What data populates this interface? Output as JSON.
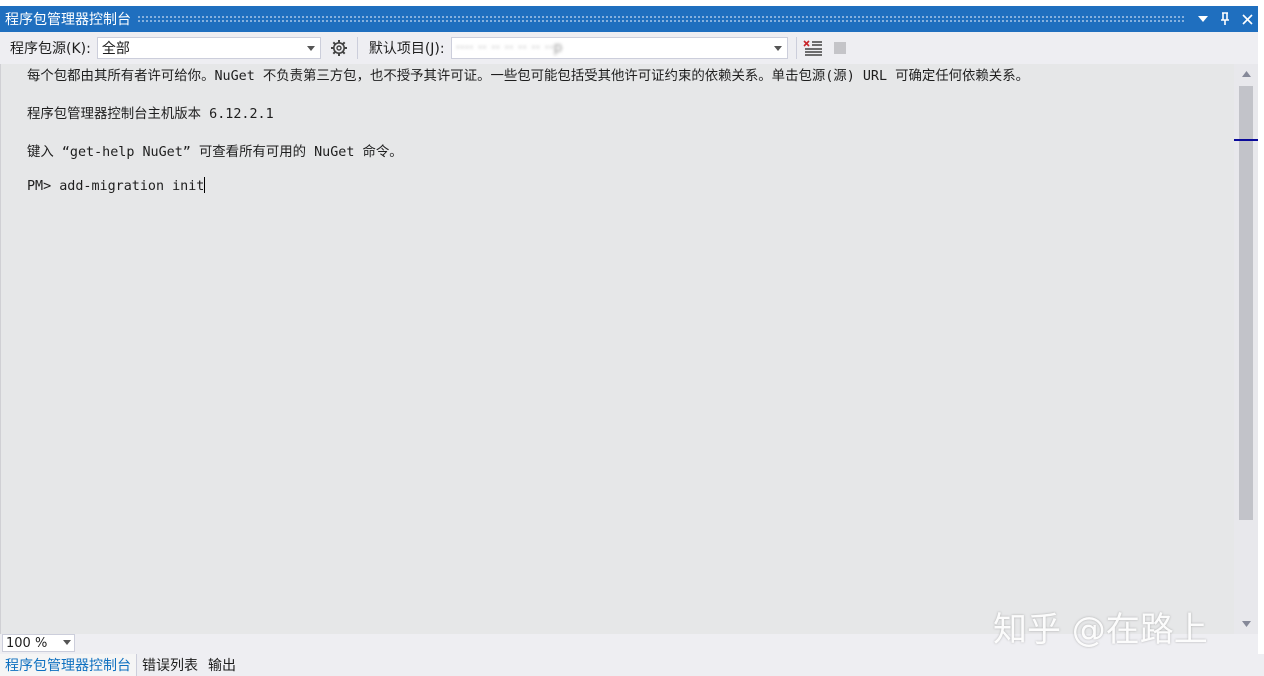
{
  "window": {
    "title": "程序包管理器控制台",
    "buttons": {
      "dropdown": "▾",
      "pin": "⊥",
      "close": "✕"
    }
  },
  "toolbar": {
    "source_label": "程序包源(K):",
    "source_value": "全部",
    "default_project_label": "默认项目(J):",
    "default_project_value": "···· ·· ·· ·· ·· ·· ··p"
  },
  "console": {
    "lines": [
      "每个包都由其所有者许可给你。NuGet 不负责第三方包，也不授予其许可证。一些包可能包括受其他许可证约束的依赖关系。单击包源(源) URL 可确定任何依赖关系。",
      "程序包管理器控制台主机版本 6.12.2.1",
      "键入 “get-help NuGet” 可查看所有可用的 NuGet 命令。",
      "PM> add-migration init"
    ]
  },
  "zoom": {
    "value": "100 %"
  },
  "tabs": [
    {
      "label": "程序包管理器控制台",
      "active": true
    },
    {
      "label": "错误列表",
      "active": false
    },
    {
      "label": "输出",
      "active": false
    }
  ],
  "watermark": "知乎 @在路上",
  "colors": {
    "title_bar": "#1f6fbf",
    "console_bg": "#e6e7e8",
    "active_tab": "#0e70c0"
  }
}
